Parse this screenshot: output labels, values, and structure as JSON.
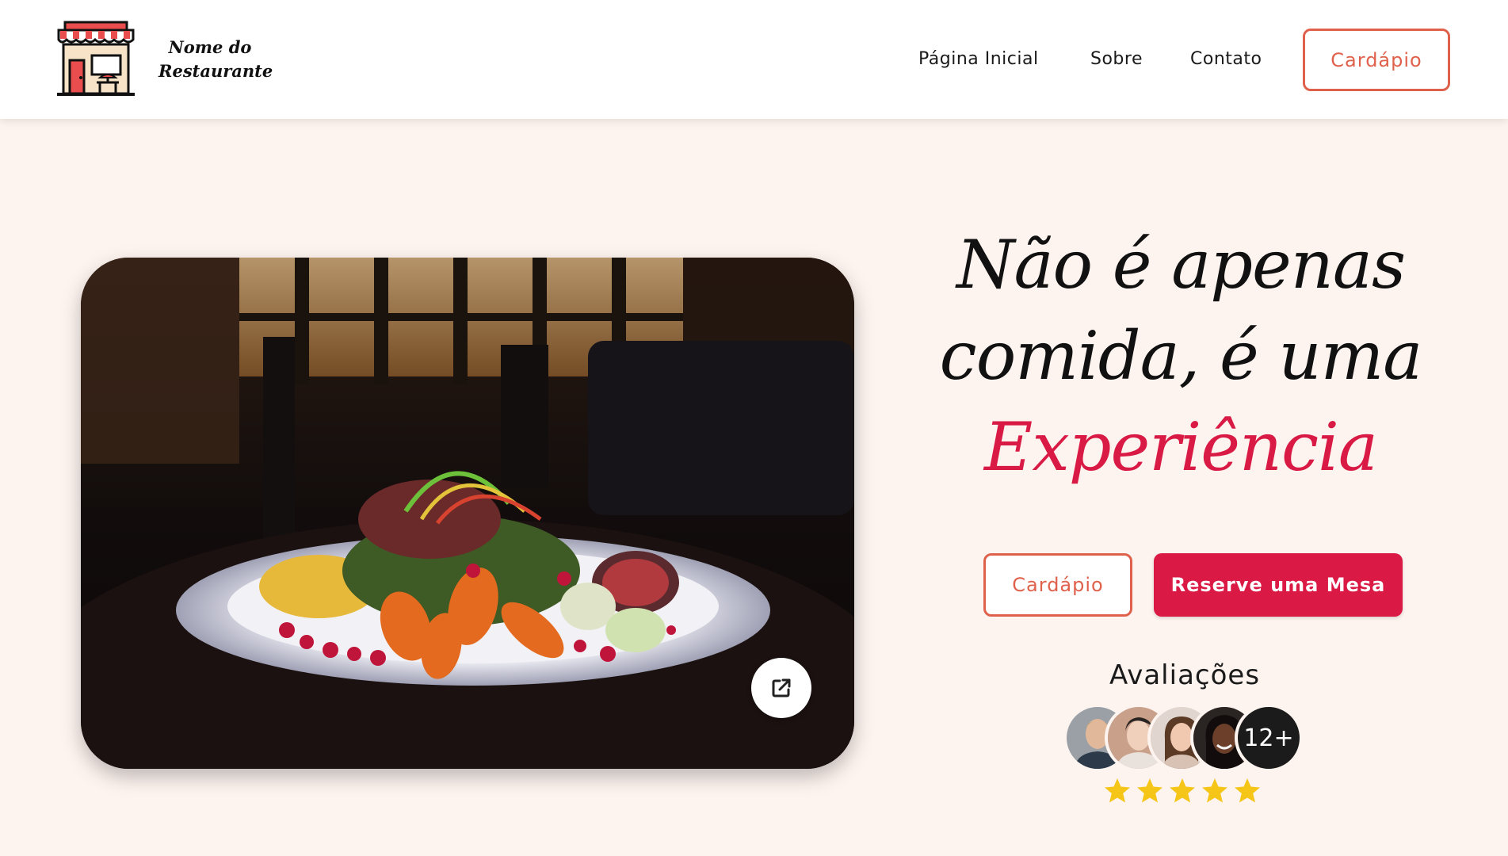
{
  "brand": {
    "name_line1": "Nome do",
    "name_line2": "Restaurante",
    "logo_icon": "storefront-icon"
  },
  "nav": {
    "items": [
      {
        "label": "Página Inicial"
      },
      {
        "label": "Sobre"
      },
      {
        "label": "Contato"
      }
    ],
    "cta_label": "Cardápio"
  },
  "hero": {
    "headline_line1": "Não é apenas",
    "headline_line2": "comida, é uma",
    "headline_accent": "Experiência",
    "menu_button": "Cardápio",
    "reserve_button": "Reserve uma Mesa",
    "expand_icon": "external-link-icon"
  },
  "reviews": {
    "title": "Avaliações",
    "more_count": "12+",
    "rating": 5,
    "max_rating": 5
  },
  "colors": {
    "accent": "#da1a45",
    "outline": "#e0614b",
    "background": "#fdf3ef",
    "star": "#f5c518"
  }
}
